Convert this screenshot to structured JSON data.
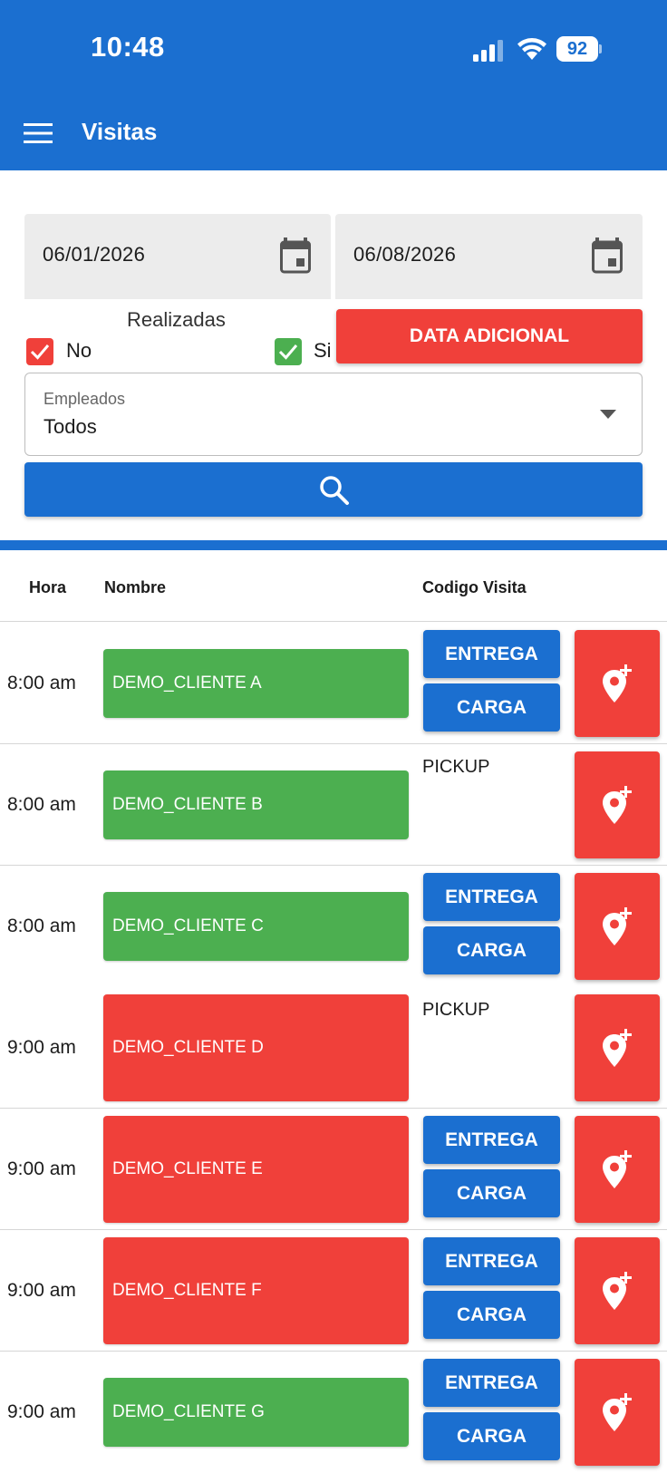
{
  "status_bar": {
    "time": "10:48",
    "battery": "92"
  },
  "header": {
    "title": "Visitas"
  },
  "filters": {
    "date_start": "06/01/2026",
    "date_end": "06/08/2026",
    "realizadas_label": "Realizadas",
    "no_label": "No",
    "no_checked": true,
    "si_label": "Si",
    "si_checked": true,
    "data_adicional_label": "DATA ADICIONAL",
    "empleados_label": "Empleados",
    "empleados_value": "Todos"
  },
  "table": {
    "columns": {
      "hora": "Hora",
      "nombre": "Nombre",
      "codigo": "Codigo Visita"
    },
    "rows": [
      {
        "hora": "8:00 am",
        "nombre": "DEMO_CLIENTE A",
        "status_color": "green",
        "codigo": [
          "ENTREGA",
          "CARGA"
        ]
      },
      {
        "hora": "8:00 am",
        "nombre": "DEMO_CLIENTE B",
        "status_color": "green",
        "codigo": [
          "PICKUP"
        ]
      },
      {
        "hora": "8:00 am",
        "nombre": "DEMO_CLIENTE C",
        "status_color": "green",
        "codigo": [
          "ENTREGA",
          "CARGA"
        ]
      },
      {
        "hora": "9:00 am",
        "nombre": "DEMO_CLIENTE D",
        "status_color": "red",
        "codigo": [
          "PICKUP"
        ]
      },
      {
        "hora": "9:00 am",
        "nombre": "DEMO_CLIENTE E",
        "status_color": "red",
        "codigo": [
          "ENTREGA",
          "CARGA"
        ]
      },
      {
        "hora": "9:00 am",
        "nombre": "DEMO_CLIENTE F",
        "status_color": "red",
        "codigo": [
          "ENTREGA",
          "CARGA"
        ]
      },
      {
        "hora": "9:00 am",
        "nombre": "DEMO_CLIENTE G",
        "status_color": "green",
        "codigo": [
          "ENTREGA",
          "CARGA"
        ]
      }
    ]
  },
  "colors": {
    "primary": "#1b6fd0",
    "accent_red": "#f0403a",
    "success_green": "#4caf50"
  },
  "icons": {
    "menu": "hamburger-menu-icon",
    "calendar": "calendar-icon",
    "search": "search-icon",
    "dropdown": "dropdown-arrow-icon",
    "location_add": "add-location-icon"
  }
}
